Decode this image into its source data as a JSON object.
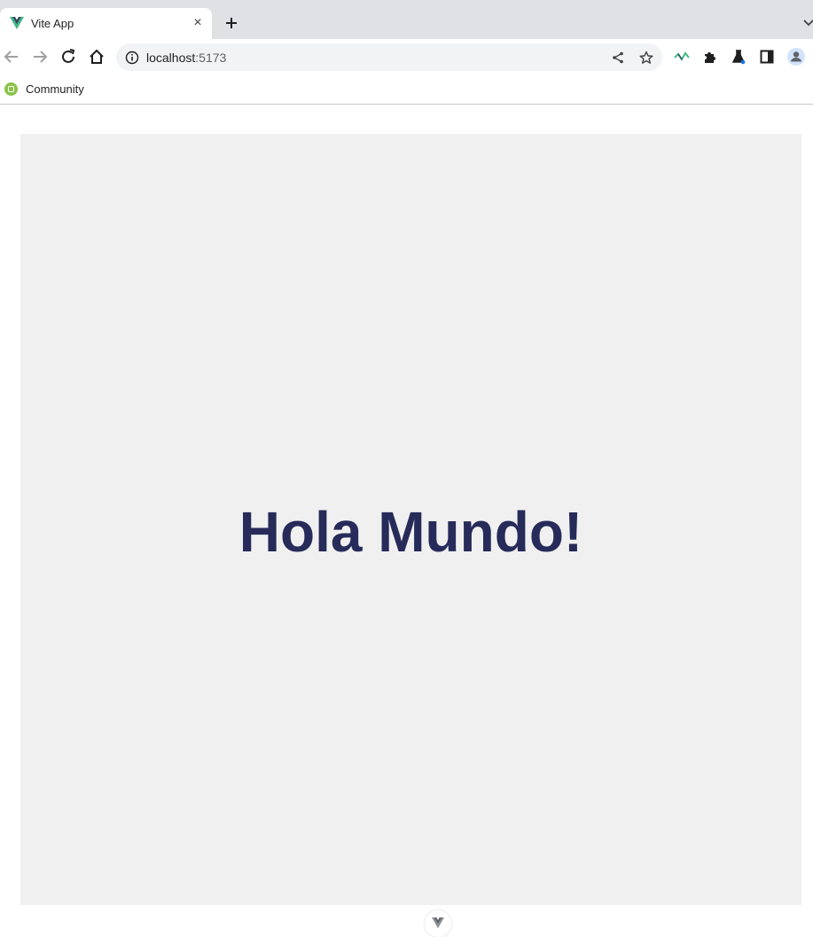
{
  "browser": {
    "tab": {
      "title": "Vite App",
      "favicon": "vue-logo-icon",
      "close_glyph": "×"
    },
    "new_tab_icon": "plus-icon",
    "tab_search_icon": "chevron-down-icon",
    "toolbar": {
      "back_icon": "arrow-left-icon",
      "forward_icon": "arrow-right-icon",
      "reload_icon": "reload-icon",
      "home_icon": "home-icon",
      "url_host": "localhost",
      "url_port": ":5173",
      "site_info_icon": "info-icon",
      "share_icon": "share-icon",
      "bookmark_star_icon": "star-icon",
      "extensions": [
        "vue-devtools-icon",
        "puzzle-icon",
        "lab-flask-icon",
        "side-panel-icon",
        "profile-avatar-icon"
      ]
    },
    "bookmarks": [
      {
        "label": "Community",
        "icon": "community-icon"
      }
    ]
  },
  "page": {
    "heading": "Hola Mundo!",
    "devtools_button_icon": "vue-devtools-icon"
  },
  "colors": {
    "tabstrip_bg": "#dfe1e5",
    "panel_bg": "#f0f0f0",
    "heading": "#262b59",
    "vue_green": "#41b883",
    "vue_dark": "#34495e",
    "community_icon": "#8bc34a"
  }
}
